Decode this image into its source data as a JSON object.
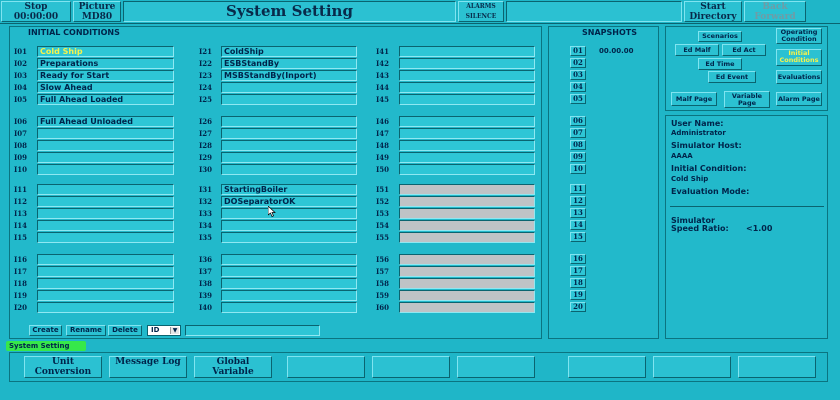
{
  "topbar": {
    "stop_label": "Stop",
    "timer": "00:00:00",
    "picture_label": "Picture",
    "picture_value": "MD80",
    "title": "System Setting",
    "alarms_label": "ALARMS",
    "silence_label": "SILENCE",
    "start_label": "Start",
    "directory_label": "Directory",
    "back_label": "Back",
    "forward_label": "Forward"
  },
  "initial_conditions": {
    "title": "INITIAL CONDITIONS",
    "col1": [
      {
        "id": "I01",
        "value": "Cold Ship",
        "highlight": true
      },
      {
        "id": "I02",
        "value": "Preparations"
      },
      {
        "id": "I03",
        "value": "Ready for Start"
      },
      {
        "id": "I04",
        "value": "Slow Ahead"
      },
      {
        "id": "I05",
        "value": "Full Ahead Loaded"
      },
      {
        "id": "I06",
        "value": "Full Ahead Unloaded"
      },
      {
        "id": "I07",
        "value": ""
      },
      {
        "id": "I08",
        "value": ""
      },
      {
        "id": "I09",
        "value": ""
      },
      {
        "id": "I10",
        "value": ""
      },
      {
        "id": "I11",
        "value": ""
      },
      {
        "id": "I12",
        "value": ""
      },
      {
        "id": "I13",
        "value": ""
      },
      {
        "id": "I14",
        "value": ""
      },
      {
        "id": "I15",
        "value": ""
      },
      {
        "id": "I16",
        "value": ""
      },
      {
        "id": "I17",
        "value": ""
      },
      {
        "id": "I18",
        "value": ""
      },
      {
        "id": "I19",
        "value": ""
      },
      {
        "id": "I20",
        "value": ""
      }
    ],
    "col2": [
      {
        "id": "I21",
        "value": "ColdShip"
      },
      {
        "id": "I22",
        "value": "ESBStandBy"
      },
      {
        "id": "I23",
        "value": "MSBStandBy(Inport)"
      },
      {
        "id": "I24",
        "value": ""
      },
      {
        "id": "I25",
        "value": ""
      },
      {
        "id": "I26",
        "value": ""
      },
      {
        "id": "I27",
        "value": ""
      },
      {
        "id": "I28",
        "value": ""
      },
      {
        "id": "I29",
        "value": ""
      },
      {
        "id": "I30",
        "value": ""
      },
      {
        "id": "I31",
        "value": "StartingBoiler"
      },
      {
        "id": "I32",
        "value": "DOSeparatorOK"
      },
      {
        "id": "I33",
        "value": ""
      },
      {
        "id": "I34",
        "value": ""
      },
      {
        "id": "I35",
        "value": ""
      },
      {
        "id": "I36",
        "value": ""
      },
      {
        "id": "I37",
        "value": ""
      },
      {
        "id": "I38",
        "value": ""
      },
      {
        "id": "I39",
        "value": ""
      },
      {
        "id": "I40",
        "value": ""
      }
    ],
    "col3": [
      {
        "id": "I41",
        "value": ""
      },
      {
        "id": "I42",
        "value": ""
      },
      {
        "id": "I43",
        "value": ""
      },
      {
        "id": "I44",
        "value": ""
      },
      {
        "id": "I45",
        "value": ""
      },
      {
        "id": "I46",
        "value": ""
      },
      {
        "id": "I47",
        "value": ""
      },
      {
        "id": "I48",
        "value": ""
      },
      {
        "id": "I49",
        "value": ""
      },
      {
        "id": "I50",
        "value": ""
      },
      {
        "id": "I51",
        "value": "",
        "disabled": true
      },
      {
        "id": "I52",
        "value": "",
        "disabled": true
      },
      {
        "id": "I53",
        "value": "",
        "disabled": true
      },
      {
        "id": "I54",
        "value": "",
        "disabled": true
      },
      {
        "id": "I55",
        "value": "",
        "disabled": true
      },
      {
        "id": "I56",
        "value": "",
        "disabled": true
      },
      {
        "id": "I57",
        "value": "",
        "disabled": true
      },
      {
        "id": "I58",
        "value": "",
        "disabled": true
      },
      {
        "id": "I59",
        "value": "",
        "disabled": true
      },
      {
        "id": "I60",
        "value": "",
        "disabled": true
      }
    ],
    "create_label": "Create",
    "rename_label": "Rename",
    "delete_label": "Delete",
    "id_select_value": "ID"
  },
  "snapshots": {
    "title": "SNAPSHOTS",
    "items": [
      {
        "num": "01",
        "time": "00.00.00"
      },
      {
        "num": "02",
        "time": ""
      },
      {
        "num": "03",
        "time": ""
      },
      {
        "num": "04",
        "time": ""
      },
      {
        "num": "05",
        "time": ""
      },
      {
        "num": "06",
        "time": ""
      },
      {
        "num": "07",
        "time": ""
      },
      {
        "num": "08",
        "time": ""
      },
      {
        "num": "09",
        "time": ""
      },
      {
        "num": "10",
        "time": ""
      },
      {
        "num": "11",
        "time": ""
      },
      {
        "num": "12",
        "time": ""
      },
      {
        "num": "13",
        "time": ""
      },
      {
        "num": "14",
        "time": ""
      },
      {
        "num": "15",
        "time": ""
      },
      {
        "num": "16",
        "time": ""
      },
      {
        "num": "17",
        "time": ""
      },
      {
        "num": "18",
        "time": ""
      },
      {
        "num": "19",
        "time": ""
      },
      {
        "num": "20",
        "time": ""
      }
    ]
  },
  "actions": {
    "scenarios": "Scenarios",
    "operating_condition": "Operating Condition",
    "initial_conditions": "Initial Conditions",
    "ed_malf": "Ed Malf",
    "ed_act": "Ed Act",
    "ed_time": "Ed Time",
    "ed_event": "Ed Event",
    "evaluations": "Evaluations",
    "malf_page": "Malf Page",
    "variable_page": "Variable Page",
    "alarm_page": "Alarm Page"
  },
  "info": {
    "user_name_label": "User Name:",
    "user_name": "Administrator",
    "host_label": "Simulator Host:",
    "host": "AAAA",
    "ic_label": "Initial Condition:",
    "ic": "Cold Ship",
    "eval_label": "Evaluation Mode:",
    "eval": "",
    "speed_label_1": "Simulator",
    "speed_label_2": "Speed Ratio:",
    "speed": "<1.00"
  },
  "status": "System Setting",
  "bottom": {
    "unit_conversion": "Unit Conversion",
    "message_log": "Message Log",
    "global_variable": "Global Variable"
  },
  "colors": {
    "background": "#1fb6c8",
    "highlight_text": "#f7f24a",
    "status_bg": "#36e84a"
  }
}
